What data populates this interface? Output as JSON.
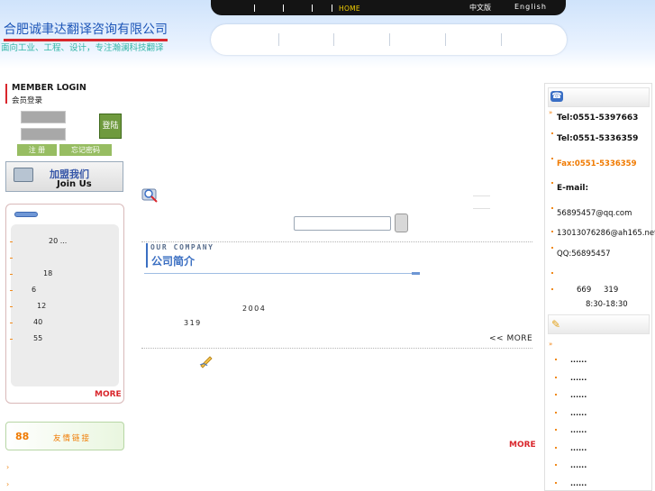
{
  "header": {
    "company_name": "合肥诚聿达翻译咨询有限公司",
    "slogan": "面向工业、工程、设计，专注瀚澜科技翻译",
    "topbar": {
      "home": "HOME",
      "lang_cn": "中文版",
      "lang_en": "English"
    }
  },
  "login": {
    "title_en": "MEMBER LOGIN",
    "title_cn": "会员登录",
    "submit_label": "登陆",
    "register_label": "注 册",
    "forgot_label": "忘记密码"
  },
  "join_banner": {
    "cn": "加盟我们",
    "en": "Join  Us"
  },
  "news": {
    "items": [
      "20 ...",
      "18",
      "6",
      "12",
      "40",
      "55"
    ],
    "more": "MORE"
  },
  "links_banner": {
    "icon_text": "88",
    "label": "友情链接"
  },
  "company": {
    "title_en": "OUR COMPANY",
    "title_cn": "公司简介",
    "year": "2004",
    "number": "319",
    "more": "<< MORE",
    "more2": "MORE"
  },
  "contact": {
    "tel1": "Tel:0551-5397663",
    "tel2": "Tel:0551-5336359",
    "fax": "Fax:0551-5336359",
    "email_label": "E-mail:",
    "email1": "56895457@qq.com",
    "email2": "13013076286@ah165.net",
    "qq": "QQ:56895457",
    "addr_a": "669",
    "addr_b": "319",
    "hours": "8:30-18:30"
  },
  "right_news": {
    "items": [
      "......",
      "......",
      "......",
      "......",
      "......",
      "......",
      "......",
      "......"
    ]
  },
  "colors": {
    "accent_red": "#d9262c",
    "accent_orange": "#f07a00",
    "brand_blue": "#1d56b8",
    "topbar": "#141414"
  }
}
